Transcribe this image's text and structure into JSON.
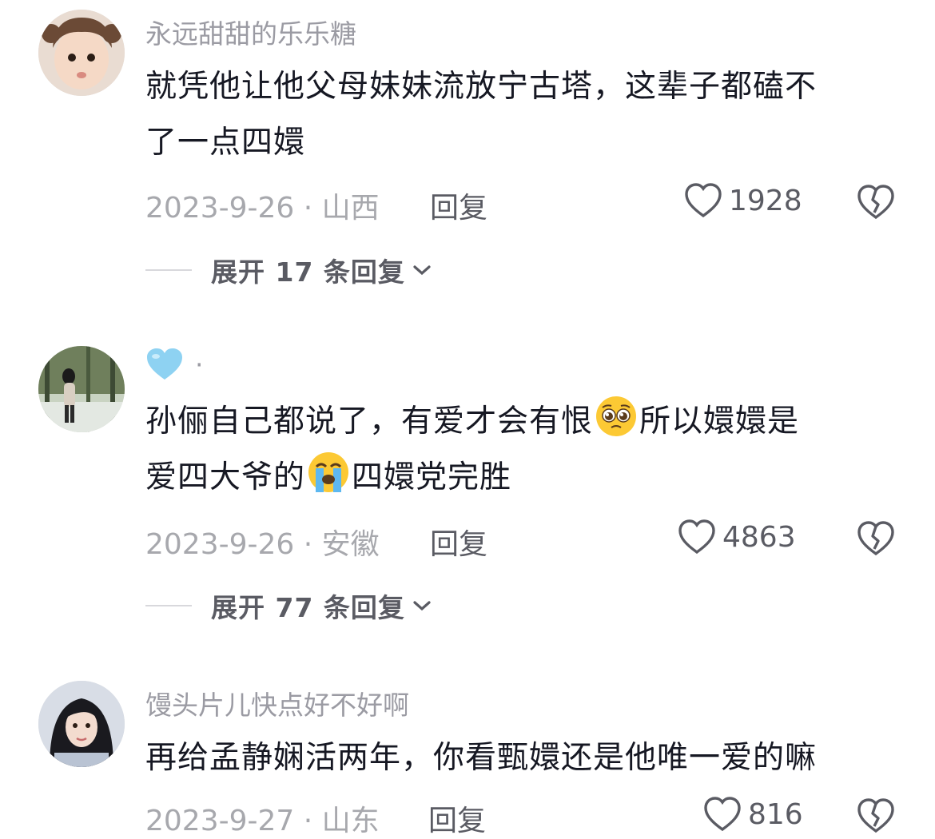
{
  "comments": [
    {
      "username": "永远甜甜的乐乐糖",
      "lines": [
        "就凭他让他父母妹妹流放宁古塔，这辈子都磕不",
        "了一点四嬛"
      ],
      "date_location": "2023-9-26 · 山西",
      "reply_label": "回复",
      "likes": "1928",
      "expand_label": "展开 17 条回复"
    },
    {
      "username": "·",
      "username_icon": "light-blue-heart-emoji",
      "line1_a": "孙俪自己都说了，有爱才会有恨",
      "line1_emoji": "pleading-face-emoji",
      "line1_b": "所以嬛嬛是",
      "line2_a": "爱四大爷的",
      "line2_emoji": "loudly-crying-face-emoji",
      "line2_b": "四嬛党完胜",
      "date_location": "2023-9-26 · 安徽",
      "reply_label": "回复",
      "likes": "4863",
      "expand_label": "展开 77 条回复"
    },
    {
      "username": "馒头片儿快点好不好啊",
      "lines": [
        "再给孟静娴活两年，你看甄嬛还是他唯一爱的嘛"
      ],
      "date_location": "2023-9-27 · 山东",
      "reply_label": "回复",
      "likes": "816"
    }
  ],
  "colors": {
    "text_primary": "#161823",
    "text_secondary": "#9b9ba3",
    "action": "#5a5b63"
  }
}
